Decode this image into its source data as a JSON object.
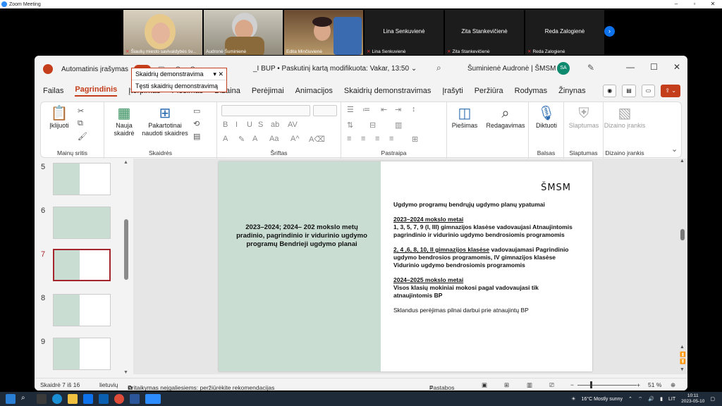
{
  "zoom": {
    "window_title": "Zoom Meeting",
    "participants": [
      {
        "name": "Šiaulių miesto savivaldybės šv...",
        "video": true
      },
      {
        "name": "Audronė Šuminienė",
        "video": true
      },
      {
        "name": "Edita Minčiuvienė",
        "video": true
      },
      {
        "name": "Lina Senkuvienė",
        "video": false
      },
      {
        "name": "Zita Stankevičienė",
        "video": false
      },
      {
        "name": "Reda Zalogienė",
        "video": false
      }
    ]
  },
  "powerpoint": {
    "autosave_label": "Automatinis įrašymas",
    "doc_title": "_I BUP • Paskutinį kartą modifikuota: Vakar, 13:50",
    "doc_title_caret": "⌄",
    "user_name": "Šuminienė Audronė | ŠMSM",
    "user_initials": "SA",
    "dropdown": {
      "selected": "Skaidrių demonstravima",
      "option": "Tęsti skaidrių demonstravimą"
    },
    "tabs": [
      "Failas",
      "Pagrindinis",
      "Įterpimas",
      "Piešimas",
      "Dizaina",
      "Perėjimai",
      "Animacijos",
      "Skaidrių demonstravimas",
      "Įrašyti",
      "Peržiūra",
      "Rodymas",
      "Žinynas"
    ],
    "active_tab": "Pagrindinis",
    "ribbon": {
      "paste": "Įklijuoti",
      "clipboard_group": "Mainų sritis",
      "new_slide": "Nauja skaidrė",
      "reuse_slides": "Pakartotinai naudoti skaidres",
      "slides_group": "Skaidrės",
      "font_group": "Šriftas",
      "paragraph_group": "Pastraipa",
      "drawing": "Piešimas",
      "editing": "Redagavimas",
      "dictate": "Diktuoti",
      "voice_group": "Balsas",
      "sensitivity": "Slaptumas",
      "sensitivity_group": "Slaptumas",
      "designer": "Dizaino įrankis",
      "designer_group": "Dizaino įrankis"
    },
    "thumbnails": [
      "5",
      "6",
      "7",
      "8",
      "9"
    ],
    "selected_slide": "7",
    "slide": {
      "left_title": "2023–2024; 2024– 202 mokslo metų pradinio, pagrindinio ir vidurinio ugdymo programų Bendrieji ugdymo planai",
      "org": "ŠMSM",
      "heading": "Ugdymo programų bendrųjų ugdymo planų ypatumai",
      "p1_title": "2023–2024 mokslo metai",
      "p1_body": " 1, 3, 5, 7, 9 (I, III) gimnazijos klasėse vadovaujasi Atnaujintomis pagrindinio ir vidurinio ugdymo bendrosiomis programomis",
      "p2_title": "2, 4 ,6, 8, 10, II gimnazijos klasėse",
      "p2_body": " vadovaujamasi Pagrindinio ugdymo bendrosios programomis, IV gimnazijos klasėse Vidurinio ugdymo bendrosiomis programomis",
      "p3_title": "2024–2025 mokslo metai",
      "p3_body": "Visos klasių mokiniai mokosi pagal vadovaujasi tik atnaujintomis BP",
      "p4": " Sklandus perėjimas pilnai darbui prie atnaujintų BP"
    },
    "status": {
      "slide_count": "Skaidrė 7 iš 16",
      "language": "lietuvių",
      "accessibility": "Pritaikymas neįgaliesiems: peržiūrėkite rekomendacijas",
      "notes": "Pastabos",
      "zoom": "51 %"
    }
  },
  "taskbar": {
    "weather": "16°C  Mostly sunny",
    "lang": "LIT",
    "time": "10:11",
    "date": "2023-05-10"
  }
}
